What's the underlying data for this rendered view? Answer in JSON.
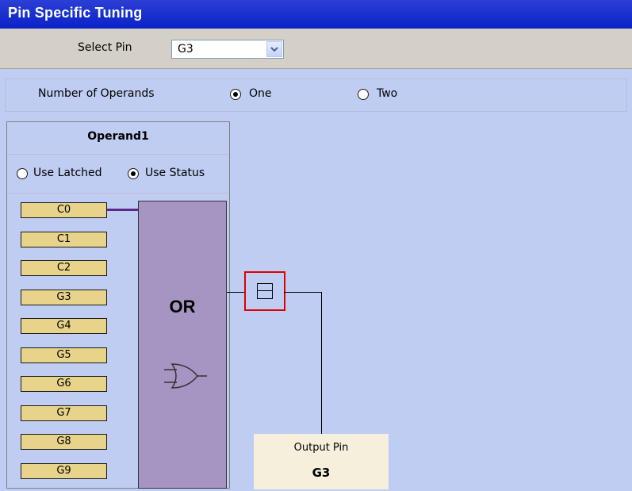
{
  "window": {
    "title": "Pin Specific Tuning"
  },
  "pin_select": {
    "label": "Select Pin",
    "value": "G3"
  },
  "operands": {
    "label": "Number of Operands",
    "options": [
      {
        "label": "One",
        "selected": true
      },
      {
        "label": "Two",
        "selected": false
      }
    ]
  },
  "operand1": {
    "title": "Operand1",
    "modes": [
      {
        "label": "Use Latched",
        "selected": false
      },
      {
        "label": "Use Status",
        "selected": true
      }
    ],
    "inputs": [
      "C0",
      "C1",
      "C2",
      "G3",
      "G4",
      "G5",
      "G6",
      "G7",
      "G8",
      "G9"
    ],
    "connected_input": "C0"
  },
  "gate": {
    "label": "OR",
    "icon": "or-gate-icon"
  },
  "output": {
    "label": "Output Pin",
    "value": "G3"
  },
  "colors": {
    "title_bar": "#0a22c6",
    "background": "#c0cdf2",
    "gate_fill": "#a695c3",
    "input_fill": "#e8d38a",
    "highlight_border": "#e00000",
    "connection_wire": "#5a2a86",
    "output_fill": "#f5efdc"
  }
}
